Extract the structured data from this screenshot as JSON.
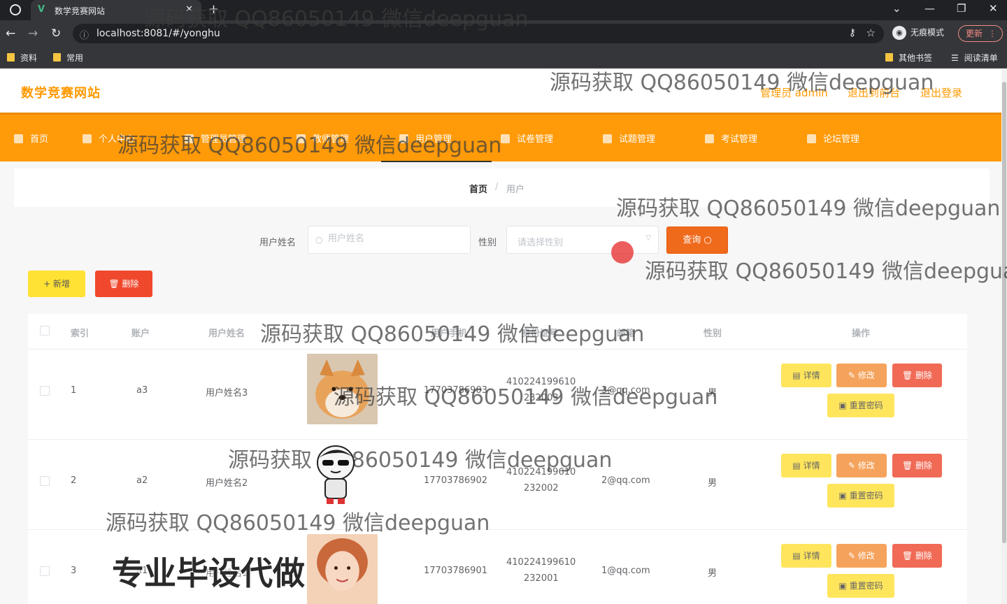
{
  "browser": {
    "tab_title": "数学竞赛网站",
    "tab_favicon": "V",
    "url": "localhost:8081/#/yonghu",
    "incognito_label": "无痕模式",
    "update_label": "更新",
    "bookmarks": [
      "资料",
      "常用"
    ],
    "bookmarks_right": [
      "其他书签",
      "阅读清单"
    ]
  },
  "site": {
    "title": "数学竞赛网站",
    "admin_label": "管理员 admin",
    "back_front": "退出到前台",
    "logout": "退出登录"
  },
  "nav": [
    {
      "label": "首页"
    },
    {
      "label": "个人中心"
    },
    {
      "label": "管理员管理"
    },
    {
      "label": "教师管理"
    },
    {
      "label": "用户管理"
    },
    {
      "label": "试卷管理"
    },
    {
      "label": "试题管理"
    },
    {
      "label": "考试管理"
    },
    {
      "label": "论坛管理"
    }
  ],
  "breadcrumb": {
    "home": "首页",
    "sep": "/",
    "current": "用户"
  },
  "search": {
    "name_label": "用户姓名",
    "name_placeholder": "用户姓名",
    "gender_label": "性别",
    "gender_placeholder": "请选择性别",
    "query_label": "查询 ○"
  },
  "actions": {
    "add_label": "+ 新增",
    "delete_label": "删除"
  },
  "table": {
    "headers": [
      "索引",
      "账户",
      "用户姓名",
      "用户手机",
      "身份证号",
      "邮箱",
      "性别",
      "操作"
    ],
    "rows": [
      {
        "index": "1",
        "account": "a3",
        "name": "用户姓名3",
        "phone": "17703786903",
        "id1": "410224199610",
        "id2": "232003",
        "email": "3@qq.com",
        "gender": "男"
      },
      {
        "index": "2",
        "account": "a2",
        "name": "用户姓名2",
        "phone": "17703786902",
        "id1": "410224199610",
        "id2": "232002",
        "email": "2@qq.com",
        "gender": "男"
      },
      {
        "index": "3",
        "account": "a1",
        "name": "用户姓名1",
        "phone": "17703786901",
        "id1": "410224199610",
        "id2": "232001",
        "email": "1@qq.com",
        "gender": "男"
      }
    ],
    "ops": {
      "detail": "详情",
      "edit": "修改",
      "delete": "删除",
      "reset": "重置密码"
    }
  },
  "overlay": {
    "watermark": "源码获取 QQ86050149 微信deepguan",
    "watermark_cut": "源码获取 QQ86050149 微信deepgua",
    "ad": "专业毕设代做"
  },
  "colors": {
    "accent": "#ff9a08",
    "query": "#f06a1c",
    "danger": "#f0482d",
    "warn": "#ffe233"
  }
}
